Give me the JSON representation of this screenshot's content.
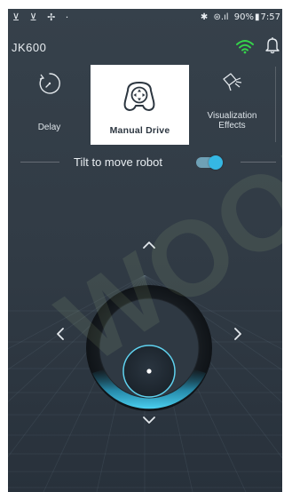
{
  "status_bar": {
    "left_icons": "⊻ ⊻ ✢ ·",
    "bluetooth": "✱",
    "signal": "⊜.ıl",
    "battery_text": "90%",
    "battery_icon": "▮",
    "time": "7:57"
  },
  "header": {
    "title": "JK600",
    "wifi_color": "#35d34b"
  },
  "modes": [
    {
      "label": "Delay",
      "icon": "timer-icon",
      "selected": false
    },
    {
      "label": "Manual Drive",
      "icon": "gamepad-icon",
      "selected": true
    },
    {
      "label": "Visualization\nEffects",
      "icon": "projector-icon",
      "selected": false
    }
  ],
  "tilt": {
    "label": "Tilt to move robot",
    "enabled": true,
    "accent_color": "#35b7e3"
  },
  "joystick": {
    "accent_color": "#37b6d8",
    "arrows": [
      "up",
      "left",
      "right",
      "down"
    ]
  },
  "watermark": {
    "text": "WOORI"
  }
}
